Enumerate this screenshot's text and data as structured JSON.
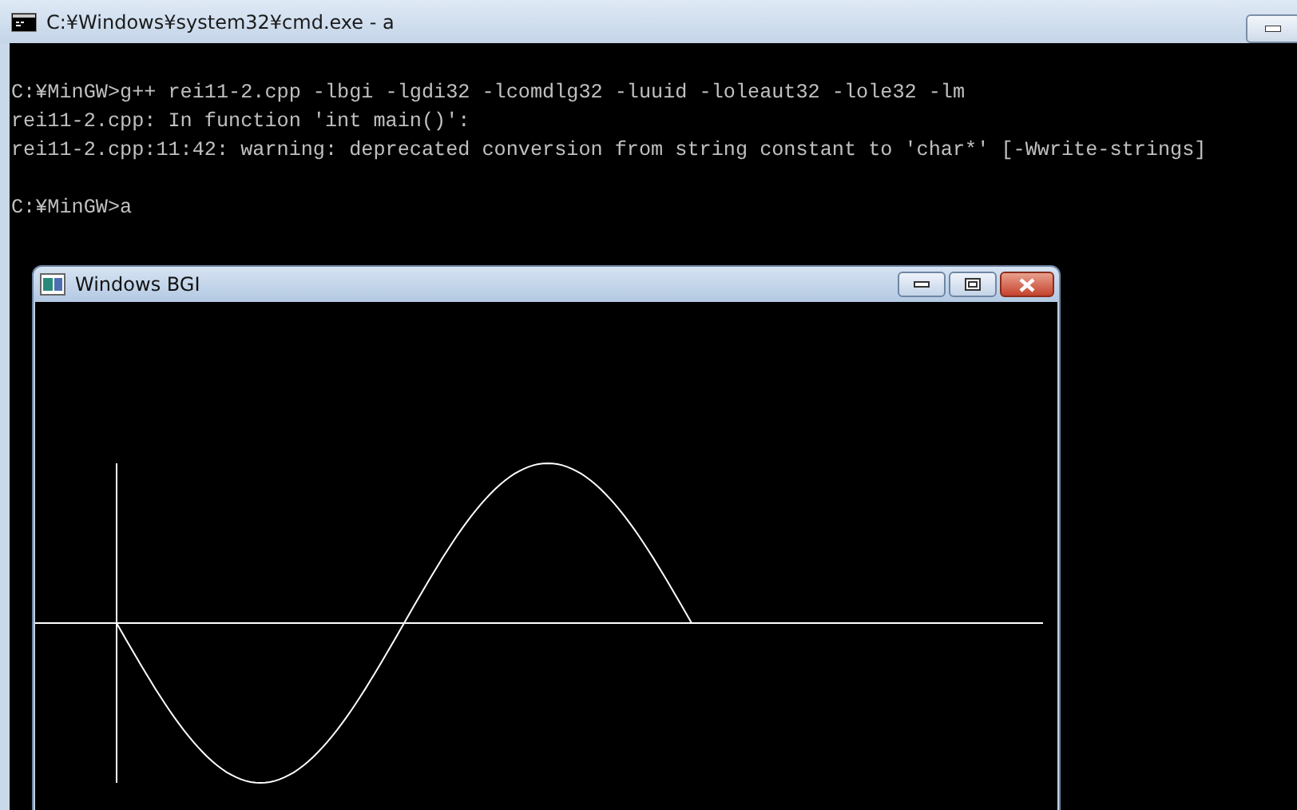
{
  "console_window": {
    "title": "C:¥Windows¥system32¥cmd.exe - a",
    "output_blocks": [
      [
        "C:¥MinGW>g++ rei11-2.cpp -lbgi -lgdi32 -lcomdlg32 -luuid -loleaut32 -lole32 -lm",
        "rei11-2.cpp: In function 'int main()':",
        "rei11-2.cpp:11:42: warning: deprecated conversion from string constant to 'char*' [-Wwrite-strings]"
      ],
      [
        "C:¥MinGW>a"
      ]
    ]
  },
  "graphics_window": {
    "title": "Windows BGI"
  }
}
